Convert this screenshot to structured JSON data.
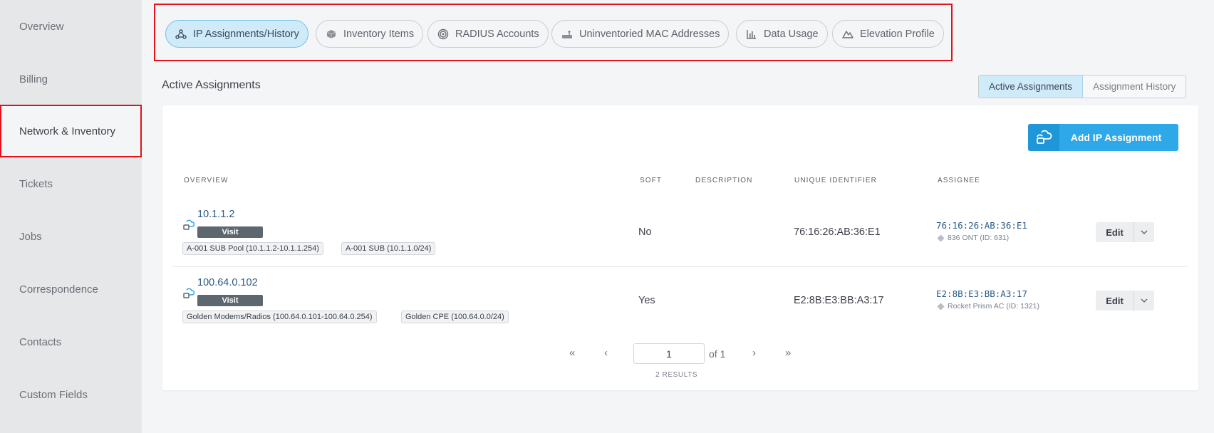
{
  "sidebar": {
    "items": [
      {
        "label": "Overview"
      },
      {
        "label": "Billing"
      },
      {
        "label": "Network & Inventory"
      },
      {
        "label": "Tickets"
      },
      {
        "label": "Jobs"
      },
      {
        "label": "Correspondence"
      },
      {
        "label": "Contacts"
      },
      {
        "label": "Custom Fields"
      }
    ]
  },
  "tabs": [
    {
      "label": "IP Assignments/History",
      "icon": "network-icon"
    },
    {
      "label": "Inventory Items",
      "icon": "cube-icon"
    },
    {
      "label": "RADIUS Accounts",
      "icon": "radius-icon"
    },
    {
      "label": "Uninventoried MAC Addresses",
      "icon": "router-icon"
    },
    {
      "label": "Data Usage",
      "icon": "bar-chart-icon"
    },
    {
      "label": "Elevation Profile",
      "icon": "mountain-icon"
    }
  ],
  "section": {
    "title": "Active Assignments",
    "toggle": [
      "Active Assignments",
      "Assignment History"
    ]
  },
  "add_button": {
    "label": "Add IP Assignment"
  },
  "table": {
    "headers": [
      "Overview",
      "Soft",
      "Description",
      "Unique Identifier",
      "Assignee"
    ],
    "rows": [
      {
        "ip": "10.1.1.2",
        "visit": "Visit",
        "pools": [
          "A-001 SUB Pool (10.1.1.2-10.1.1.254)",
          "A-001 SUB (10.1.1.0/24)"
        ],
        "soft": "No",
        "description": "",
        "unique_identifier": "76:16:26:AB:36:E1",
        "assignee_mac": "76:16:26:AB:36:E1",
        "assignee_device": "836 ONT (ID: 631)",
        "edit": "Edit"
      },
      {
        "ip": "100.64.0.102",
        "visit": "Visit",
        "pools": [
          "Golden Modems/Radios (100.64.0.101-100.64.0.254)",
          "Golden CPE (100.64.0.0/24)"
        ],
        "soft": "Yes",
        "description": "",
        "unique_identifier": "E2:8B:E3:BB:A3:17",
        "assignee_mac": "E2:8B:E3:BB:A3:17",
        "assignee_device": "Rocket Prism AC (ID: 1321)",
        "edit": "Edit"
      }
    ]
  },
  "pagination": {
    "first": "«",
    "prev": "‹",
    "page": "1",
    "of": "of 1",
    "next": "›",
    "last": "»",
    "results": "2 RESULTS"
  },
  "colors": {
    "accent": "#2fa8ea",
    "highlight": "#e2121b",
    "active_tab_bg": "#cfeaf9"
  }
}
